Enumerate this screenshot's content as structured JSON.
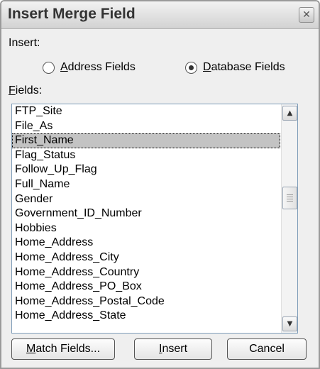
{
  "dialog": {
    "title": "Insert Merge Field",
    "close_icon": "close-icon"
  },
  "insert_section": {
    "label": "Insert:",
    "radio_address": {
      "accel": "A",
      "rest": "ddress Fields",
      "selected": false
    },
    "radio_database": {
      "accel": "D",
      "rest": "atabase Fields",
      "selected": true
    }
  },
  "fields_section": {
    "label_accel": "F",
    "label_rest": "ields:",
    "items": [
      "FTP_Site",
      "File_As",
      "First_Name",
      "Flag_Status",
      "Follow_Up_Flag",
      "Full_Name",
      "Gender",
      "Government_ID_Number",
      "Hobbies",
      "Home_Address",
      "Home_Address_City",
      "Home_Address_Country",
      "Home_Address_PO_Box",
      "Home_Address_Postal_Code",
      "Home_Address_State"
    ],
    "selected_item": "First_Name",
    "scroll_position": 0.4
  },
  "buttons": {
    "match_fields": {
      "accel": "M",
      "rest": "atch Fields..."
    },
    "insert": {
      "accel": "I",
      "rest": "nsert"
    },
    "cancel": "Cancel"
  },
  "colors": {
    "selection": "#c3c3c3",
    "list_border": "#7f9db9"
  }
}
